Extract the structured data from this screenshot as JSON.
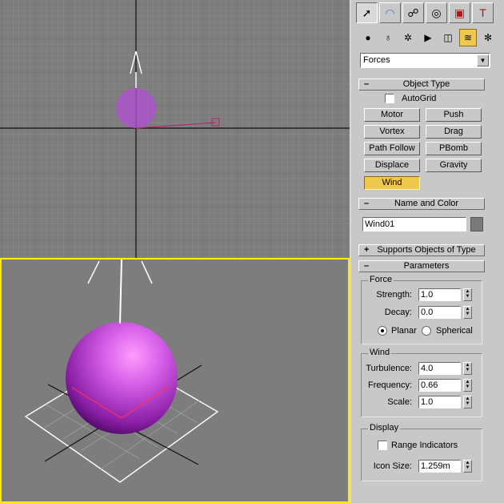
{
  "viewports": {
    "top": {
      "active": false
    },
    "perspective": {
      "active": true,
      "border_color": "#ffec00"
    }
  },
  "command_panel": {
    "tabs": [
      {
        "name": "create",
        "icon": "pointer-icon",
        "active": true
      },
      {
        "name": "modify",
        "icon": "rainbow-icon",
        "active": false
      },
      {
        "name": "hierarchy",
        "icon": "hierarchy-icon",
        "active": false
      },
      {
        "name": "motion",
        "icon": "motion-wheel-icon",
        "active": false
      },
      {
        "name": "display",
        "icon": "monitor-icon",
        "active": false
      },
      {
        "name": "utilities",
        "icon": "hammer-icon",
        "active": false
      }
    ],
    "subtabs": [
      {
        "name": "geometry",
        "icon": "sphere-icon"
      },
      {
        "name": "shapes",
        "icon": "shapes-icon"
      },
      {
        "name": "lights",
        "icon": "light-icon"
      },
      {
        "name": "cameras",
        "icon": "camera-icon"
      },
      {
        "name": "helpers",
        "icon": "helper-icon"
      },
      {
        "name": "space-warps",
        "icon": "wave-icon",
        "active": true
      },
      {
        "name": "systems",
        "icon": "gear-icon"
      }
    ],
    "category": "Forces",
    "object_type": {
      "title": "Object Type",
      "autogrid_label": "AutoGrid",
      "autogrid_checked": false,
      "buttons": [
        "Motor",
        "Push",
        "Vortex",
        "Drag",
        "Path Follow",
        "PBomb",
        "Displace",
        "Gravity",
        "Wind"
      ],
      "active_button": "Wind"
    },
    "name_and_color": {
      "title": "Name and Color",
      "name_value": "Wind01",
      "color": "#7a7a7a"
    },
    "supports_objects": {
      "title": "Supports Objects of Type"
    },
    "parameters": {
      "title": "Parameters",
      "force": {
        "legend": "Force",
        "strength_label": "Strength:",
        "strength_value": "1.0",
        "decay_label": "Decay:",
        "decay_value": "0.0",
        "planar_label": "Planar",
        "spherical_label": "Spherical",
        "mode": "planar"
      },
      "wind": {
        "legend": "Wind",
        "turbulence_label": "Turbulence:",
        "turbulence_value": "4.0",
        "frequency_label": "Frequency:",
        "frequency_value": "0.66",
        "scale_label": "Scale:",
        "scale_value": "1.0"
      },
      "display": {
        "legend": "Display",
        "range_indicators_label": "Range Indicators",
        "range_indicators_checked": false,
        "icon_size_label": "Icon Size:",
        "icon_size_value": "1.259m"
      }
    }
  },
  "colors": {
    "viewport_bg": "#7d7d7d",
    "grid_line": "#8c8c8c",
    "active_viewport": "#ffec00",
    "selected_button": "#f0c84c",
    "sphere": "#b34fd6"
  }
}
